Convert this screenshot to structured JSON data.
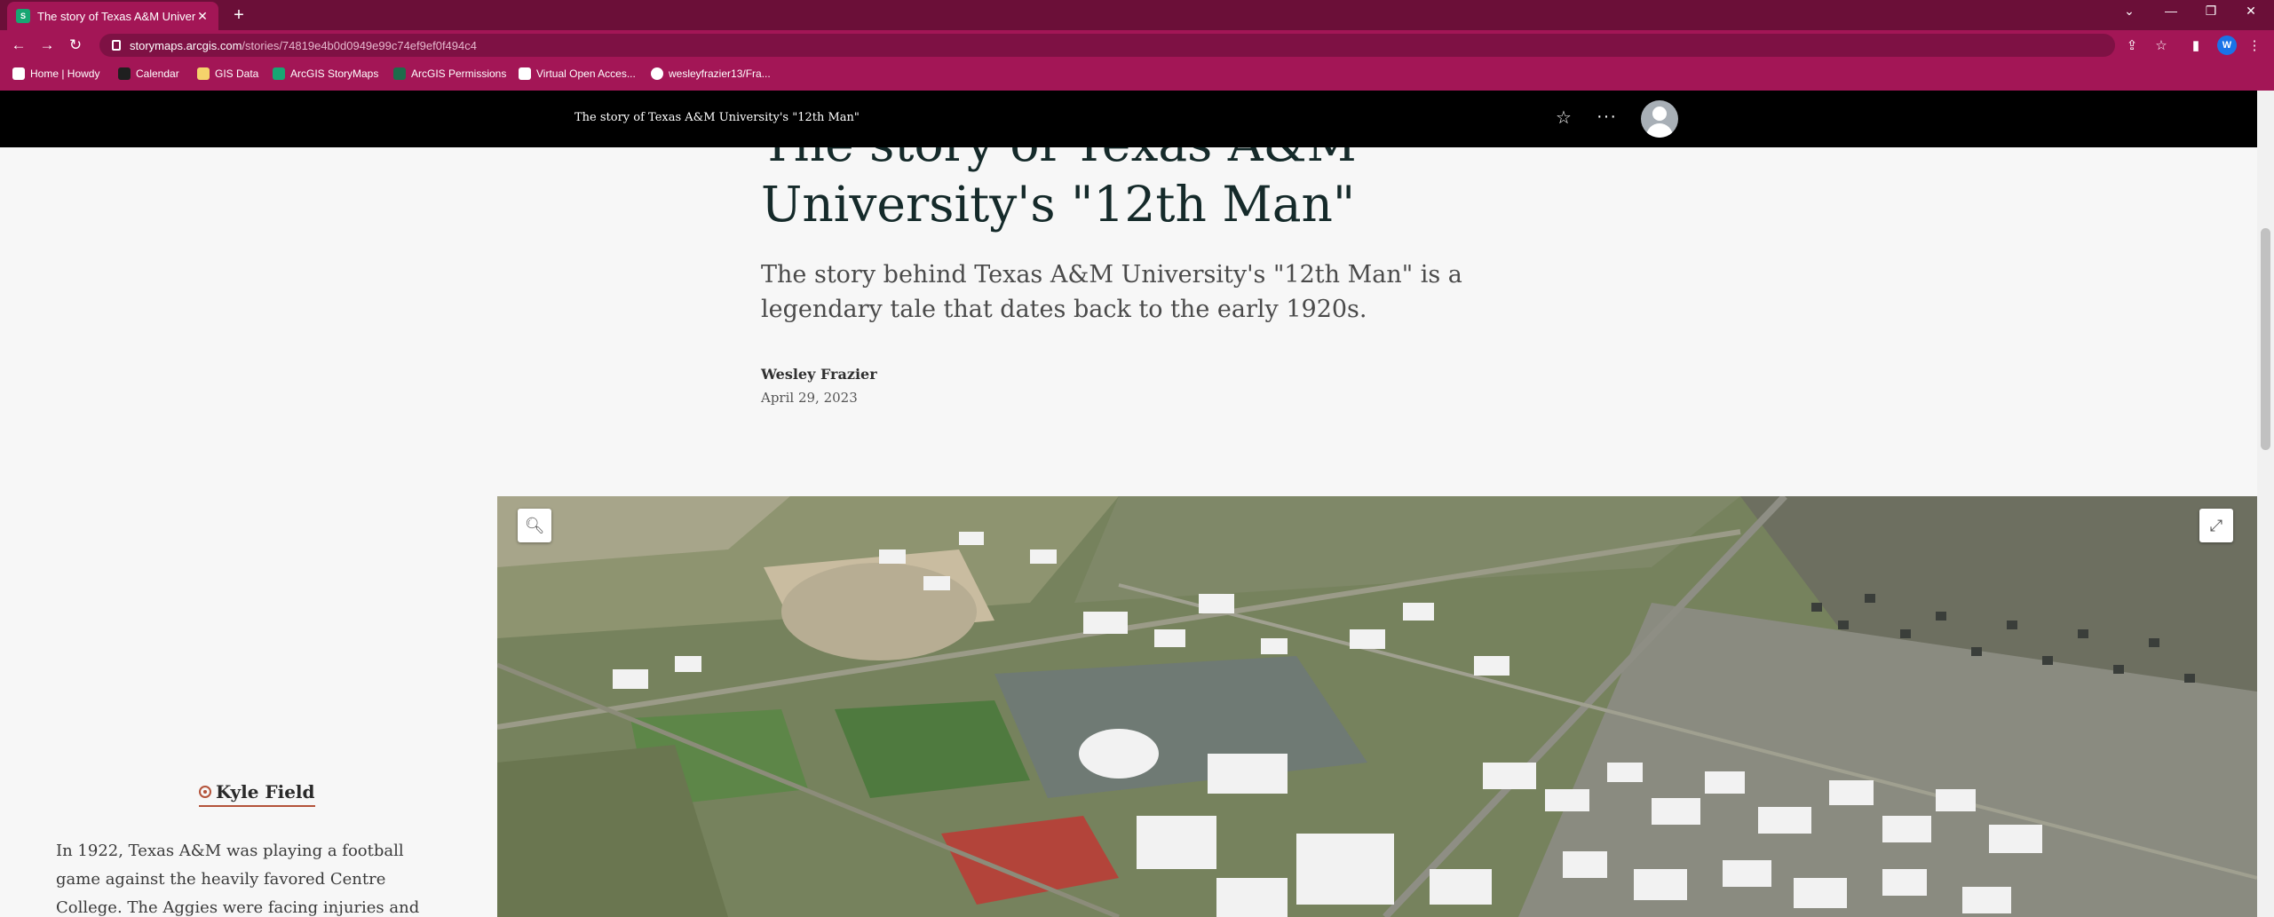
{
  "browser": {
    "tab_title": "The story of Texas A&M Universi",
    "tab_icon_text": "S",
    "url_host": "storymaps.arcgis.com",
    "url_path": "/stories/74819e4b0d0949e99c74ef9ef0f494c4",
    "profile_initial": "W",
    "bookmarks": [
      {
        "label": "Home | Howdy",
        "color": "#ffffff"
      },
      {
        "label": "Calendar",
        "color": "#1f1f1f"
      },
      {
        "label": "GIS Data",
        "color": "#f5d36b"
      },
      {
        "label": "ArcGIS StoryMaps",
        "color": "#17a673"
      },
      {
        "label": "ArcGIS Permissions",
        "color": "#1d6c4b"
      },
      {
        "label": "Virtual Open Acces...",
        "color": "#ffffff"
      },
      {
        "label": "wesleyfrazier13/Fra...",
        "color": "#ffffff"
      }
    ]
  },
  "story_header": {
    "title": "The story of Texas A&M University's \"12th Man\""
  },
  "story": {
    "title_line1": "The story of Texas A&M",
    "title_line2": "University's \"12th Man\"",
    "subtitle": "The story behind Texas A&M University's \"12th Man\" is a legendary tale that dates back to the early 1920s.",
    "author": "Wesley Frazier",
    "date": "April 29, 2023"
  },
  "sidebar": {
    "location_title": "Kyle Field",
    "paragraph": "In 1922, Texas A&M was playing a football game against the heavily favored Centre College. The Aggies were facing injuries and needed a backup"
  },
  "colors": {
    "tabstrip": "#6b0f38",
    "toolbar": "#a31656",
    "header": "#000000",
    "accent": "#b4533a"
  }
}
